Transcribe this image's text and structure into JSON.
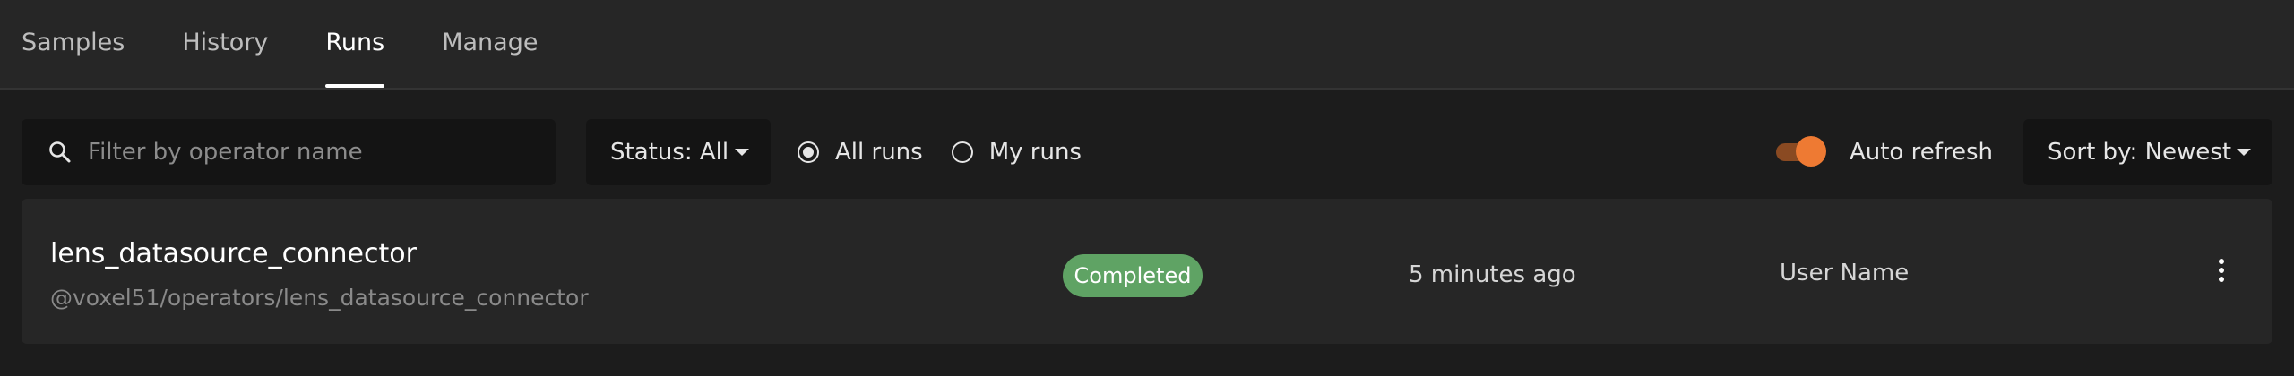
{
  "tabs": [
    {
      "label": "Samples",
      "active": false
    },
    {
      "label": "History",
      "active": false
    },
    {
      "label": "Runs",
      "active": true
    },
    {
      "label": "Manage",
      "active": false
    }
  ],
  "toolbar": {
    "search_placeholder": "Filter by operator name",
    "search_icon": "search-icon",
    "status_filter": "Status: All",
    "radio_all": "All runs",
    "radio_mine": "My runs",
    "selected_radio": "All runs",
    "auto_refresh_label": "Auto refresh",
    "auto_refresh_on": true,
    "sort_label": "Sort by: Newest"
  },
  "runs": [
    {
      "name": "lens_datasource_connector",
      "uri": "@voxel51/operators/lens_datasource_connector",
      "status": "Completed",
      "time": "5 minutes ago",
      "user": "User Name"
    }
  ],
  "colors": {
    "accent": "#ee7a33",
    "status_completed": "#5fa364"
  }
}
